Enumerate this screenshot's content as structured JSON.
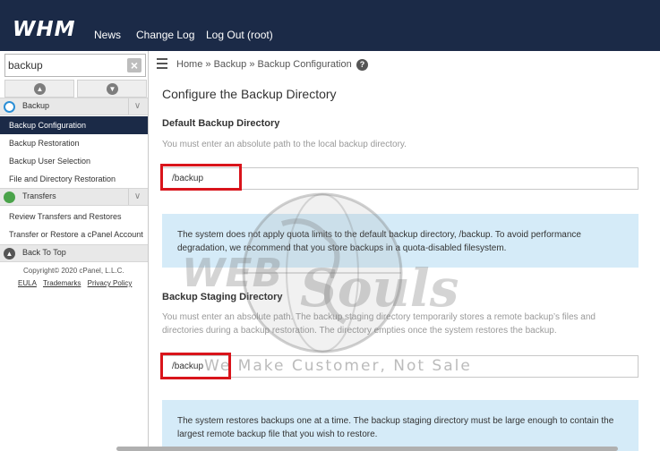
{
  "topbar": {
    "logo": "WHM",
    "nav": [
      "News",
      "Change Log",
      "Log Out (root)"
    ]
  },
  "sidebar": {
    "search_value": "backup",
    "clear_glyph": "×",
    "categories": [
      {
        "label": "Backup",
        "icon": "backup-icon",
        "color": "#2b8fd6",
        "items": [
          "Backup Configuration",
          "Backup Restoration",
          "Backup User Selection",
          "File and Directory Restoration"
        ]
      },
      {
        "label": "Transfers",
        "icon": "transfers-icon",
        "color": "#4aa34a",
        "items": [
          "Review Transfers and Restores",
          "Transfer or Restore a cPanel Account"
        ]
      }
    ],
    "back_to_top": "Back To Top",
    "copyright": "Copyright© 2020 cPanel, L.L.C.",
    "footer_links": [
      "EULA",
      "Trademarks",
      "Privacy Policy"
    ]
  },
  "breadcrumb": {
    "home": "Home",
    "sep": "»",
    "section": "Backup",
    "current": "Backup Configuration"
  },
  "main": {
    "title": "Configure the Backup Directory",
    "default_dir": {
      "heading": "Default Backup Directory",
      "help": "You must enter an absolute path to the local backup directory.",
      "value": "/backup",
      "info": "The system does not apply quota limits to the default backup directory, /backup. To avoid performance degradation, we recommend that you store backups in a quota-disabled filesystem."
    },
    "staging_dir": {
      "heading": "Backup Staging Directory",
      "help": "You must enter an absolute path. The backup staging directory temporarily stores a remote backup’s files and directories during a backup restoration. The directory empties once the system restores the backup.",
      "value": "/backup",
      "info": "The system restores backups one at a time. The backup staging directory must be large enough to contain the largest remote backup file that you wish to restore."
    }
  },
  "watermark": {
    "brand_a": "WEB",
    "brand_b": "Souls",
    "tagline": "We Make Customer, Not Sale"
  },
  "colors": {
    "topbar": "#1b2a47",
    "active_item": "#1b2a47",
    "highlight_border": "#d9141b",
    "info_bg": "#d5ebf8"
  }
}
